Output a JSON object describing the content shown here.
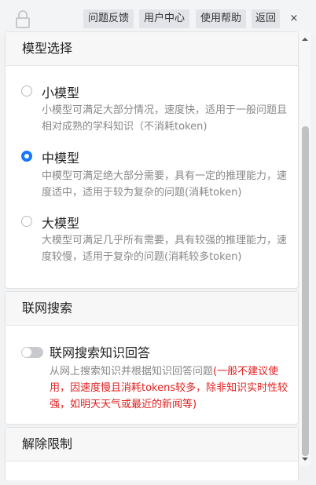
{
  "toolbar": {
    "lock_icon": "lock-icon",
    "feedback_label": "问题反馈",
    "user_center_label": "用户中心",
    "help_label": "使用帮助",
    "back_label": "返回",
    "close_label": "×"
  },
  "model_section": {
    "title": "模型选择",
    "selected": "medium",
    "options": [
      {
        "id": "small",
        "title": "小模型",
        "desc": "小模型可满足大部分情况，速度快，适用于一般问题且相对成熟的学科知识（不消耗token)",
        "checked": false
      },
      {
        "id": "medium",
        "title": "中模型",
        "desc": "中模型可满足绝大部分需要，具有一定的推理能力，速度适中，适用于较为复杂的问题(消耗token)",
        "checked": true
      },
      {
        "id": "large",
        "title": "大模型",
        "desc": "大模型可满足几乎所有需要，具有较强的推理能力，速度较慢，适用于复杂的问题(消耗较多token)",
        "checked": false
      }
    ]
  },
  "web_search_section": {
    "title": "联网搜索",
    "toggle_label": "联网搜索知识回答",
    "toggle_on": false,
    "desc_normal": "从网上搜索知识并根据知识回答问题",
    "desc_warning": "(一般不建议使用，因速度慢且消耗tokens较多，除非知识实时性较强，如明天天气或最近的新闻等)",
    "warning_color": "#e02020"
  },
  "unlock_section": {
    "title": "解除限制"
  },
  "colors": {
    "accent": "#1677ff",
    "toggle_off": "#c8c9cc"
  }
}
